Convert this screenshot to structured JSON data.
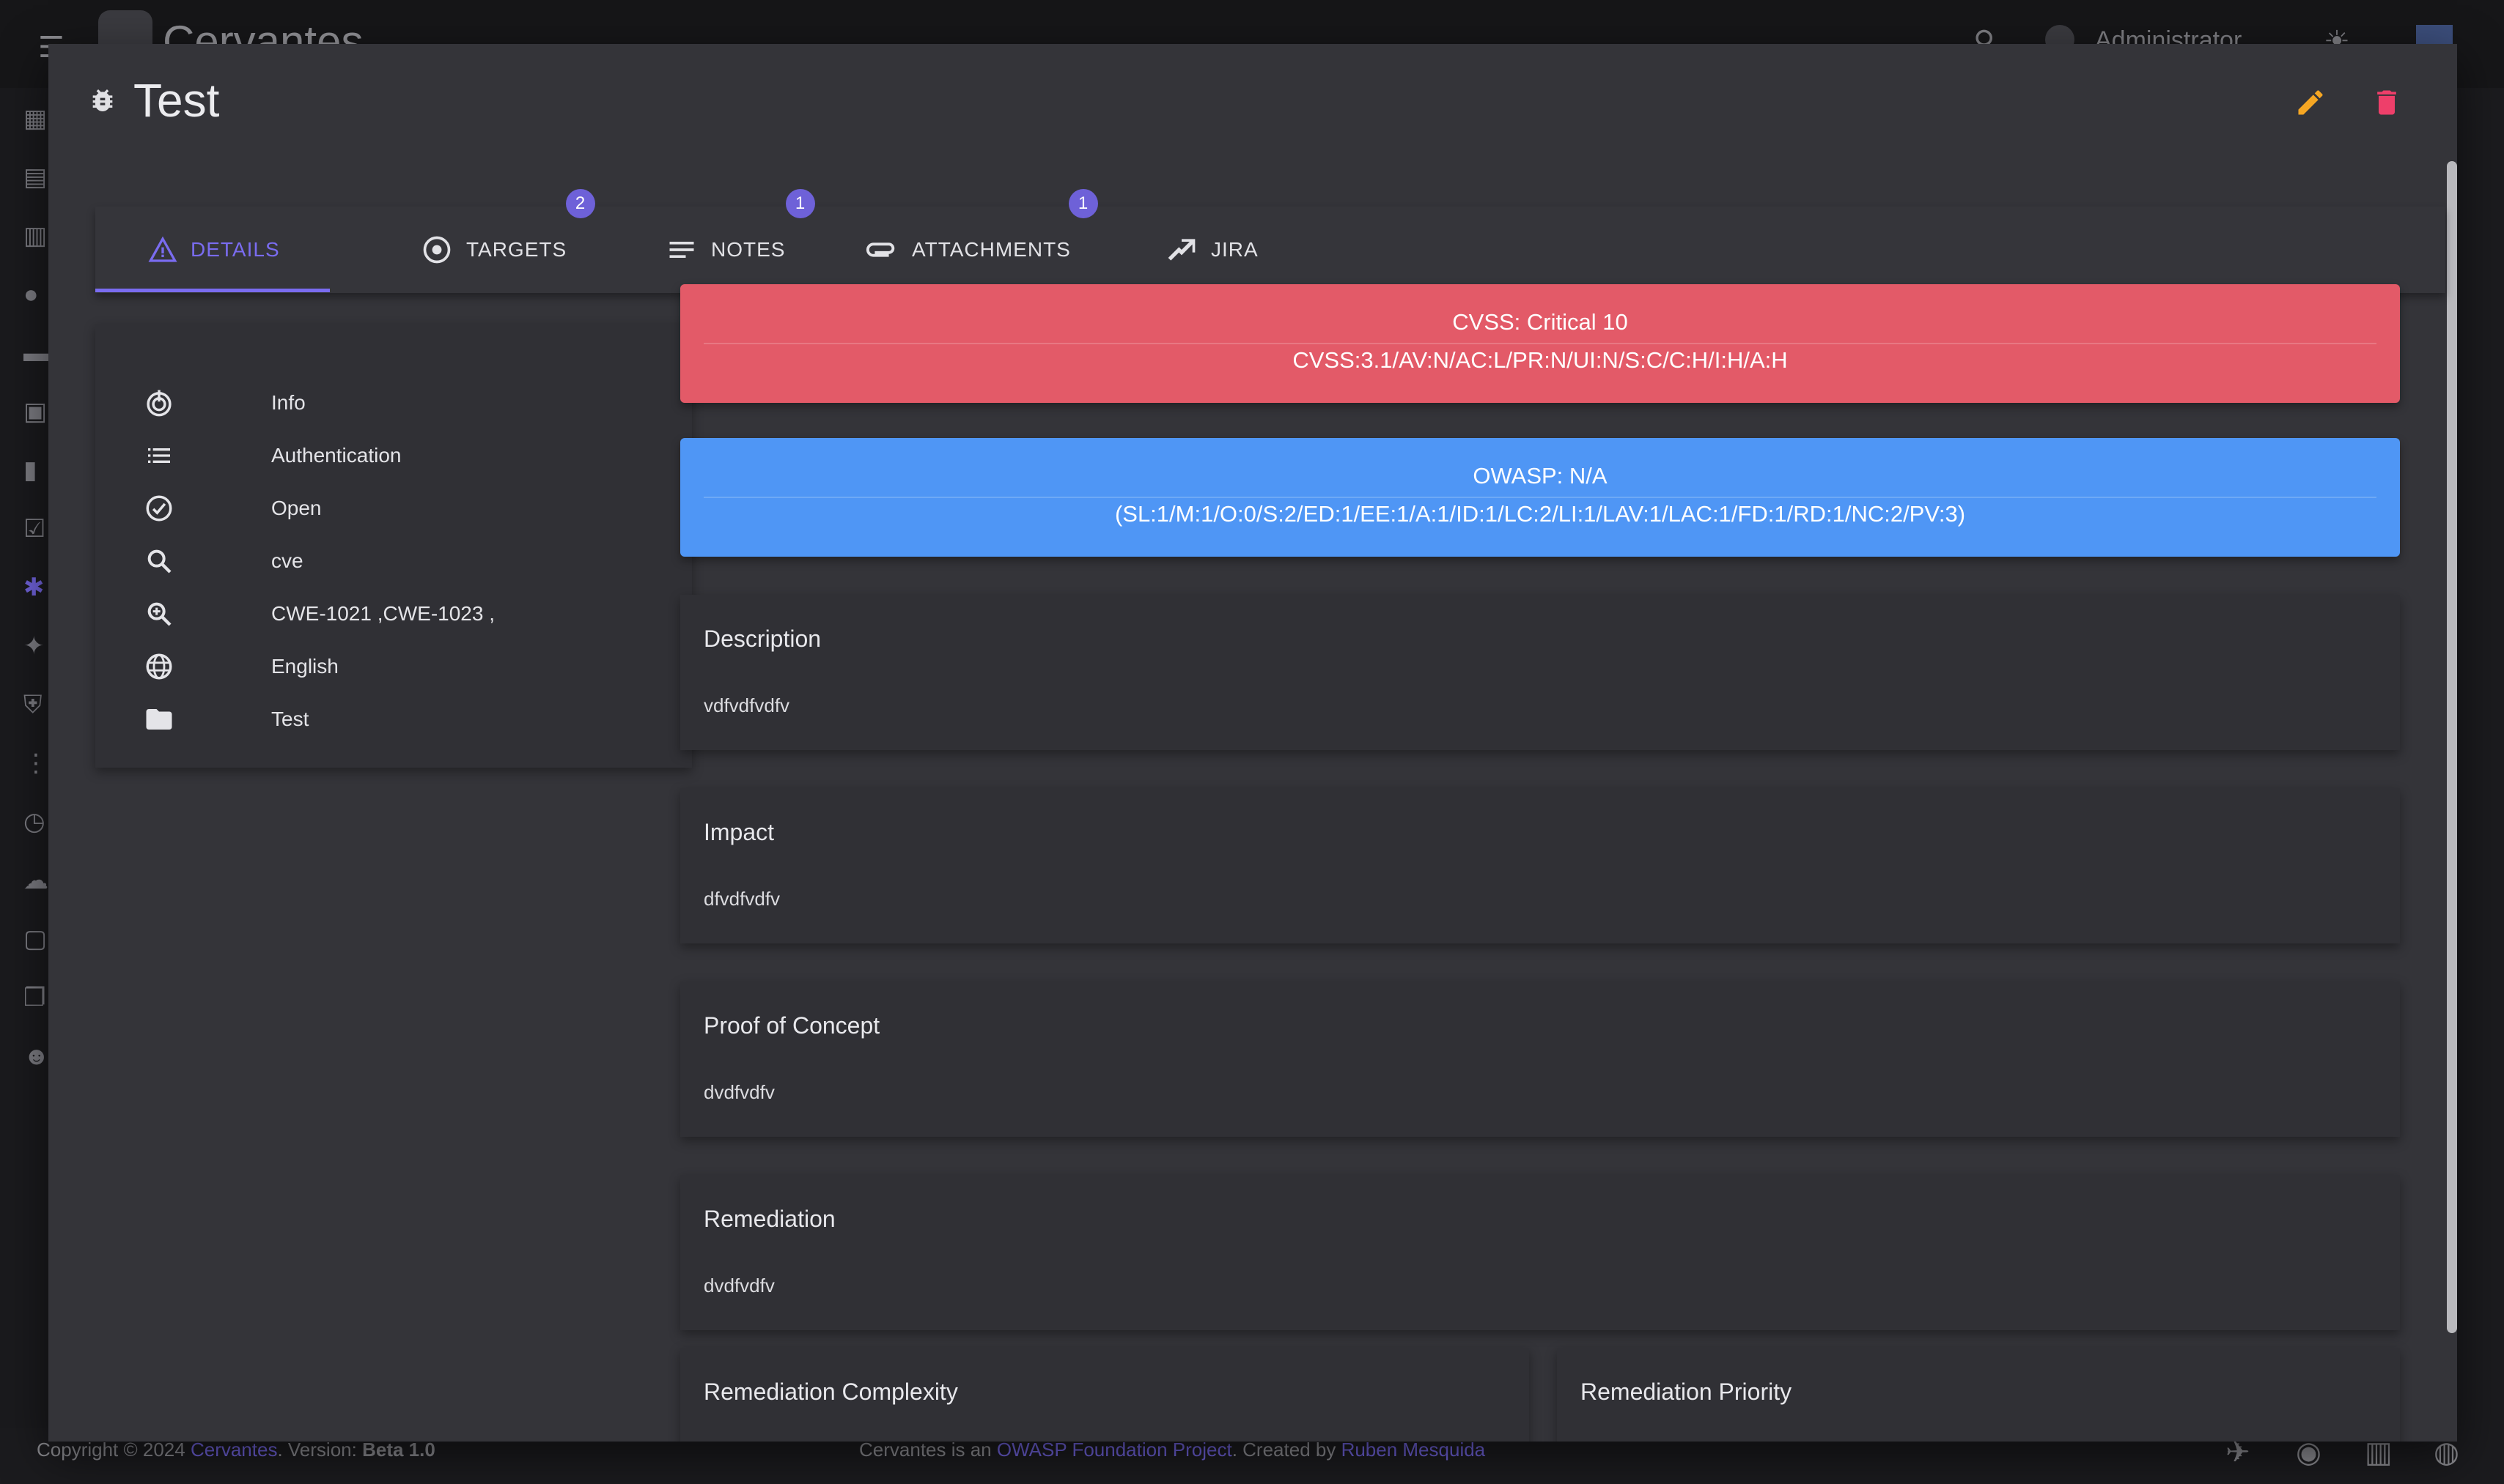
{
  "app": {
    "brand": "Cervantes",
    "user": "Administrator"
  },
  "dialog": {
    "title": "Test",
    "edit_label": "Edit",
    "delete_label": "Delete"
  },
  "tabs": [
    {
      "label": "DETAILS",
      "badge": ""
    },
    {
      "label": "TARGETS",
      "badge": "2"
    },
    {
      "label": "NOTES",
      "badge": "1"
    },
    {
      "label": "ATTACHMENTS",
      "badge": "1"
    },
    {
      "label": "JIRA",
      "badge": ""
    }
  ],
  "info": [
    {
      "icon": "risk-icon",
      "text": "Info"
    },
    {
      "icon": "list-icon",
      "text": "Authentication"
    },
    {
      "icon": "check-circle-icon",
      "text": "Open"
    },
    {
      "icon": "search-icon",
      "text": "cve"
    },
    {
      "icon": "zoom-icon",
      "text": "CWE-1021 ,CWE-1023 ,"
    },
    {
      "icon": "globe-icon",
      "text": "English"
    },
    {
      "icon": "folder-icon",
      "text": "Test"
    }
  ],
  "cvss": {
    "line1": "CVSS: Critical 10",
    "line2": "CVSS:3.1/AV:N/AC:L/PR:N/UI:N/S:C/C:H/I:H/A:H",
    "color": "#e35a68"
  },
  "owasp": {
    "line1": "OWASP: N/A",
    "line2": "(SL:1/M:1/O:0/S:2/ED:1/EE:1/A:1/ID:1/LC:2/LI:1/LAV:1/LAC:1/FD:1/RD:1/NC:2/PV:3)",
    "color": "#4f96f5"
  },
  "sections": [
    {
      "title": "Description",
      "body": "vdfvdfvdfv"
    },
    {
      "title": "Impact",
      "body": "dfvdfvdfv"
    },
    {
      "title": "Proof of Concept",
      "body": "dvdfvdfv"
    },
    {
      "title": "Remediation",
      "body": "dvdfvdfv"
    }
  ],
  "bottom": {
    "left_title": "Remediation Complexity",
    "right_title": "Remediation Priority"
  },
  "footer": {
    "copyright": "Copyright © 2024 ",
    "brand": "Cervantes",
    "version_prefix": ". Version: ",
    "version": "Beta 1.0",
    "middle_prefix": "Cervantes is an ",
    "owasp_link": "OWASP Foundation Project",
    "created_by": ". Created by ",
    "author": "Ruben Mesquida"
  },
  "accent": "#7a6cf0"
}
